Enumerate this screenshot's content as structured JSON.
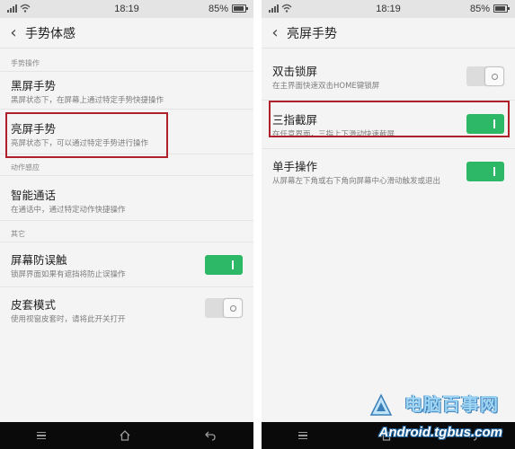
{
  "left_screen": {
    "status": {
      "time": "18:19",
      "battery": "85%"
    },
    "title": "手势体感",
    "sections": [
      {
        "header": "手势操作",
        "items": [
          {
            "title": "黑屏手势",
            "desc": "黑屏状态下，在屏幕上通过特定手势快捷操作"
          },
          {
            "title": "亮屏手势",
            "desc": "亮屏状态下，可以通过特定手势进行操作"
          }
        ]
      },
      {
        "header": "动作感应",
        "items": [
          {
            "title": "智能通话",
            "desc": "在通话中，通过特定动作快捷操作"
          }
        ]
      },
      {
        "header": "其它",
        "items": [
          {
            "title": "屏幕防误触",
            "desc": "锁屏界面如果有遮挡将防止误操作",
            "toggle": "on"
          },
          {
            "title": "皮套模式",
            "desc": "使用视窗皮套时，请将此开关打开",
            "toggle": "off"
          }
        ]
      }
    ]
  },
  "right_screen": {
    "status": {
      "time": "18:19",
      "battery": "85%"
    },
    "title": "亮屏手势",
    "items": [
      {
        "title": "双击锁屏",
        "desc": "在主界面快速双击HOME键锁屏",
        "toggle": "off"
      },
      {
        "title": "三指截屏",
        "desc": "在任意界面，三指上下滑动快速截屏",
        "toggle": "on"
      },
      {
        "title": "单手操作",
        "desc": "从屏幕左下角或右下角向屏幕中心滑动触发或退出",
        "toggle": "on"
      }
    ]
  },
  "watermark": {
    "brand": "电脑百事网",
    "site": "Android.tgbus.com"
  },
  "colors": {
    "highlight": "#b0202a",
    "toggle_on": "#2cb866",
    "toggle_off": "#dcdcdc",
    "navbar": "#0a0a0a"
  },
  "icons": [
    "signal-icon",
    "wifi-icon",
    "battery-icon",
    "back-arrow-icon",
    "menu-icon",
    "home-icon",
    "nav-back-icon"
  ]
}
